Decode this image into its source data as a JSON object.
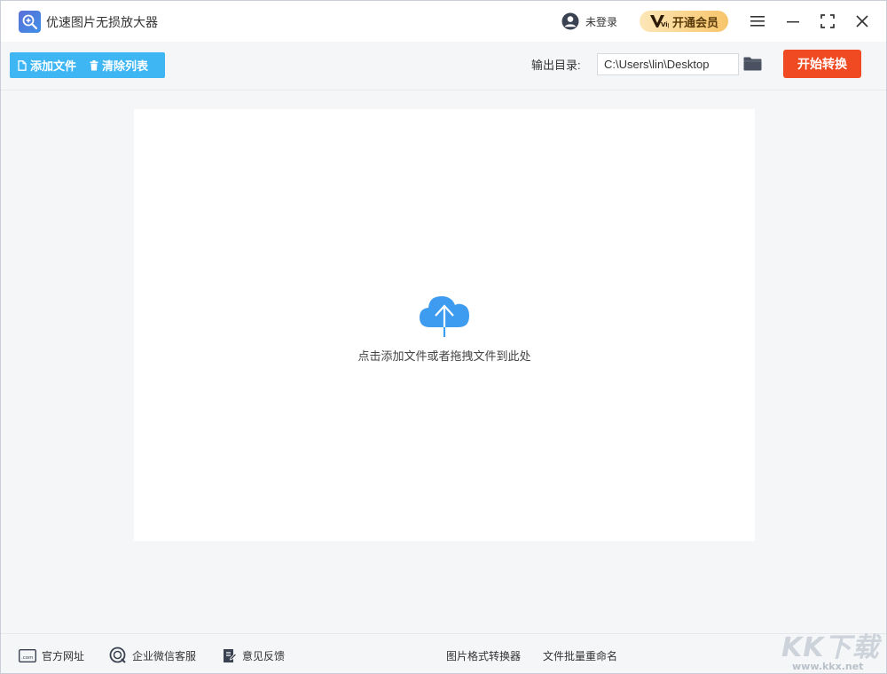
{
  "app": {
    "title": "优速图片无损放大器"
  },
  "titlebar": {
    "user_status": "未登录",
    "vip_label": "开通会员",
    "vip_badge": "Vip"
  },
  "toolbar": {
    "add_files_label": "添加文件",
    "clear_list_label": "清除列表",
    "output_dir_label": "输出目录:",
    "output_dir_value": "C:\\Users\\lin\\Desktop",
    "start_label": "开始转换"
  },
  "dropzone": {
    "hint": "点击添加文件或者拖拽文件到此处"
  },
  "footer": {
    "website_label": "官方网址",
    "website_icon_text": ".com",
    "wechat_service_label": "企业微信客服",
    "feedback_label": "意见反馈",
    "format_converter_label": "图片格式转换器",
    "batch_rename_label": "文件批量重命名"
  },
  "watermark": {
    "text": "KK下载",
    "url": "www.kkx.net"
  },
  "colors": {
    "accent_blue": "#3fb6f4",
    "start_red": "#f04a23",
    "cloud_blue": "#3d9cf0",
    "vip_gold": "#f7c56a"
  }
}
